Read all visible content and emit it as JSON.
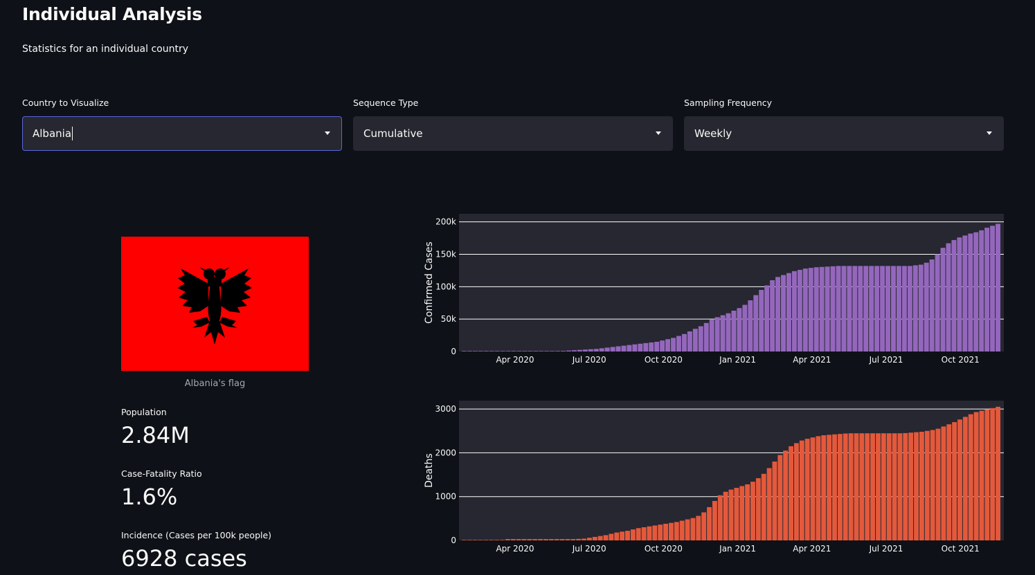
{
  "header": {
    "title": "Individual Analysis",
    "subtitle": "Statistics for an individual country"
  },
  "controls": [
    {
      "label": "Country to Visualize",
      "value": "Albania"
    },
    {
      "label": "Sequence Type",
      "value": "Cumulative"
    },
    {
      "label": "Sampling Frequency",
      "value": "Weekly"
    }
  ],
  "flag": {
    "caption": "Albania's flag",
    "colors": {
      "field": "#ff0000",
      "eagle": "#000000"
    }
  },
  "metrics": [
    {
      "label": "Population",
      "value": "2.84M"
    },
    {
      "label": "Case-Fatality Ratio",
      "value": "1.6%"
    },
    {
      "label": "Incidence (Cases per 100k people)",
      "value": "6928 cases"
    }
  ],
  "colors": {
    "accent_focus": "#5a67d8",
    "cases_bar": "#9467bd",
    "deaths_bar": "#e4593b",
    "plot_bg": "#262730",
    "app_bg": "#0e1117"
  },
  "chart_data": [
    {
      "type": "bar",
      "ylabel": "Confirmed Cases",
      "ylim": [
        0,
        205000
      ],
      "yticks": [
        0,
        50000,
        100000,
        150000,
        200000
      ],
      "ytick_labels": [
        "0",
        "50k",
        "100k",
        "150k",
        "200k"
      ],
      "xticks": [
        "Apr 2020",
        "Jul 2020",
        "Oct 2020",
        "Jan 2021",
        "Apr 2021",
        "Jul 2021",
        "Oct 2021"
      ],
      "color": "#9467bd",
      "grid": true,
      "values": [
        0,
        0,
        0,
        0,
        0,
        0,
        0,
        0,
        0,
        0,
        0,
        0,
        0,
        0,
        0,
        0,
        0,
        0,
        1000,
        1500,
        2000,
        2500,
        3000,
        3500,
        4000,
        5000,
        6000,
        7000,
        8000,
        9000,
        10000,
        11000,
        12000,
        13000,
        14000,
        15000,
        17000,
        19000,
        21000,
        24000,
        27000,
        31000,
        35000,
        39000,
        44000,
        49000,
        53000,
        56000,
        59000,
        63000,
        67000,
        72000,
        79000,
        87000,
        95000,
        102000,
        110000,
        115000,
        118000,
        121000,
        124000,
        126000,
        128000,
        129000,
        130000,
        130500,
        131000,
        131500,
        132000,
        132000,
        132000,
        132000,
        132000,
        132000,
        132000,
        132000,
        132000,
        132000,
        132000,
        132000,
        132000,
        132000,
        133000,
        134000,
        137000,
        142000,
        150000,
        160000,
        167000,
        172000,
        176000,
        179000,
        182000,
        184000,
        187000,
        191000,
        194000,
        197000
      ]
    },
    {
      "type": "bar",
      "ylabel": "Deaths",
      "ylim": [
        0,
        3080
      ],
      "yticks": [
        0,
        1000,
        2000,
        3000
      ],
      "ytick_labels": [
        "0",
        "1000",
        "2000",
        "3000"
      ],
      "xticks": [
        "Apr 2020",
        "Jul 2020",
        "Oct 2020",
        "Jan 2021",
        "Apr 2021",
        "Jul 2021",
        "Oct 2021"
      ],
      "color": "#e4593b",
      "grid": true,
      "values": [
        0,
        0,
        0,
        0,
        0,
        0,
        0,
        0,
        30,
        30,
        30,
        30,
        30,
        30,
        30,
        30,
        30,
        30,
        30,
        30,
        30,
        35,
        40,
        60,
        80,
        100,
        120,
        150,
        180,
        200,
        220,
        250,
        280,
        300,
        320,
        340,
        360,
        380,
        400,
        420,
        450,
        480,
        510,
        560,
        640,
        760,
        900,
        1030,
        1110,
        1160,
        1200,
        1240,
        1280,
        1340,
        1420,
        1520,
        1650,
        1800,
        1950,
        2050,
        2150,
        2220,
        2280,
        2320,
        2350,
        2380,
        2400,
        2410,
        2420,
        2430,
        2440,
        2445,
        2445,
        2445,
        2445,
        2445,
        2445,
        2445,
        2445,
        2445,
        2445,
        2450,
        2460,
        2470,
        2480,
        2500,
        2520,
        2550,
        2600,
        2650,
        2700,
        2760,
        2820,
        2880,
        2930,
        2960,
        2990,
        3020,
        3050
      ]
    }
  ]
}
